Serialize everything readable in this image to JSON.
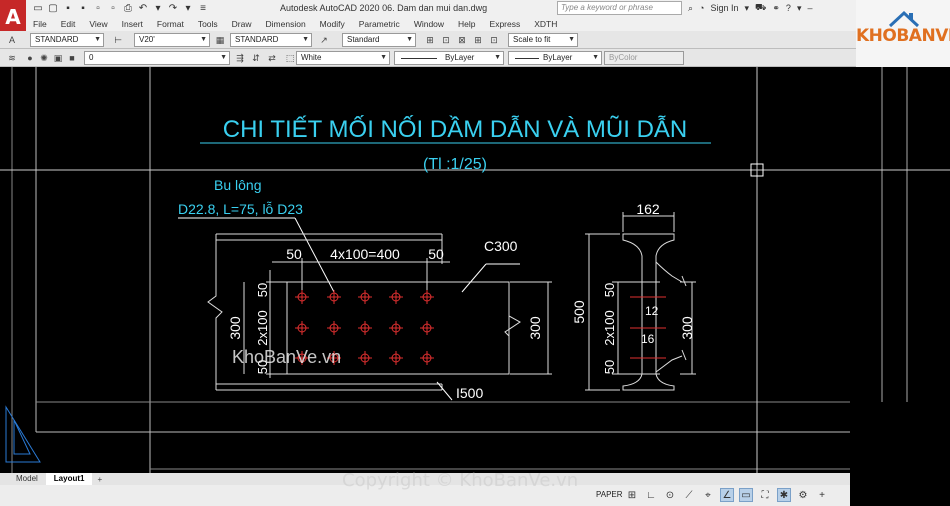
{
  "app": {
    "logo_letter": "A",
    "title": "Autodesk AutoCAD 2020    06. Dam dan mui dan.dwg",
    "search_placeholder": "Type a keyword or phrase",
    "sign_in": "Sign In"
  },
  "menu": [
    "File",
    "Edit",
    "View",
    "Insert",
    "Format",
    "Tools",
    "Draw",
    "Dimension",
    "Modify",
    "Parametric",
    "Window",
    "Help",
    "Express",
    "XDTH"
  ],
  "toolbar1": {
    "text_style": "STANDARD",
    "dim_style": "V20'",
    "table_style": "STANDARD",
    "multileader_style": "Standard",
    "scale": "Scale to fit"
  },
  "toolbar2": {
    "layer": "0",
    "color": "White",
    "linetype": "ByLayer",
    "lineweight": "ByLayer",
    "plotstyle": "ByColor"
  },
  "branding": {
    "logo_text": "KHOBANVE"
  },
  "drawing": {
    "title": "CHI TIẾT MỐI NỐI DẦM DẪN VÀ MŨI DẪN",
    "scale_text": "(Tl :1/25)",
    "bolt_label": "Bu lông",
    "bolt_spec": "D22.8, L=75, lỗ D23",
    "dim_50_left": "50",
    "dim_pitch": "4x100=400",
    "dim_50_right": "50",
    "section_c": "C300",
    "section_i": "I500",
    "dim_300_left": "300",
    "dim_300_right": "300",
    "vdim_50_top": "50",
    "vdim_2x100": "2x100",
    "vdim_50_bot": "50",
    "sec_width": "162",
    "sec_height": "500",
    "sec_50_top": "50",
    "sec_2x100": "2x100",
    "sec_50_bot": "50",
    "sec_300": "300",
    "sec_12": "12",
    "sec_16": "16",
    "watermark": "KhoBanVe.vn"
  },
  "tabs": {
    "model": "Model",
    "layout": "Layout1",
    "add": "+"
  },
  "status": {
    "space": "PAPER"
  },
  "copyright": "Copyright © KhoBanVe.vn"
}
